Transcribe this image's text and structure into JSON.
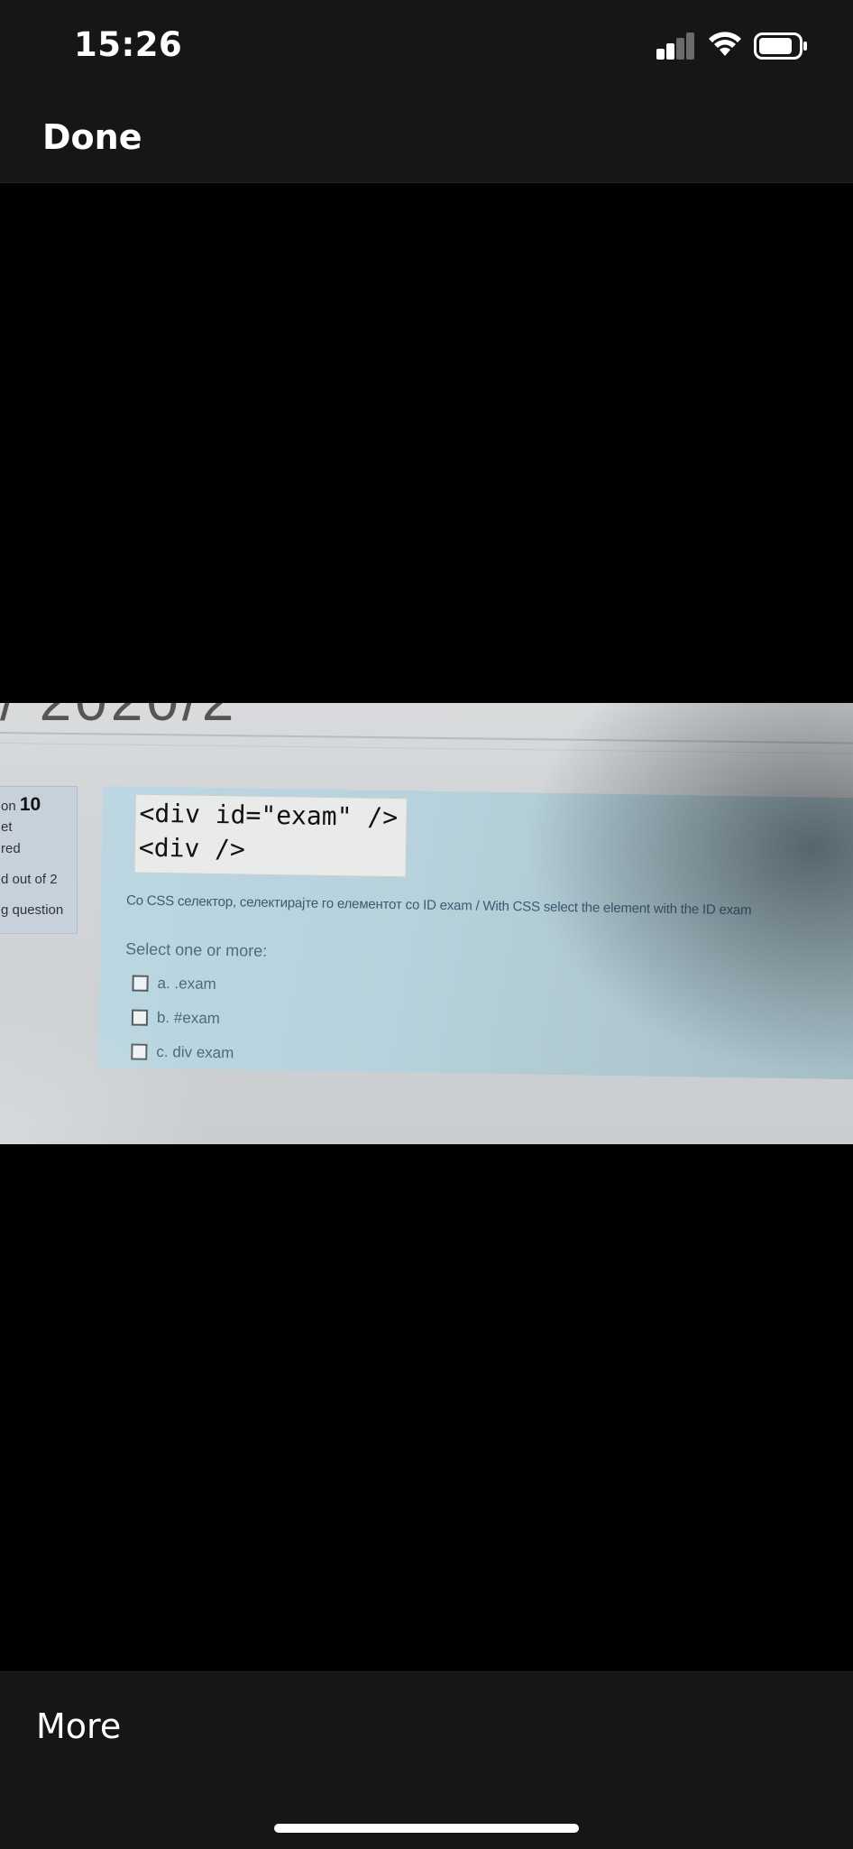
{
  "status_bar": {
    "time": "15:26",
    "signal_bars_active": 2,
    "signal_bars_total": 4
  },
  "nav": {
    "done_label": "Done"
  },
  "photo": {
    "heading_fragment": "/ 2020/2",
    "info_panel": {
      "question_prefix": "on",
      "question_number": "10",
      "line2": "et",
      "line3": "red",
      "line4": "d out of 2",
      "line5": "g question"
    },
    "code_lines": [
      "<div id=\"exam\" />",
      "<div />"
    ],
    "question_text": "Со CSS селектор, селектирајте го елементот со ID exam / With CSS select the element with the ID exam",
    "select_label": "Select one or more:",
    "options": [
      {
        "label": "a. .exam"
      },
      {
        "label": "b. #exam"
      },
      {
        "label": "c. div exam"
      }
    ]
  },
  "bottom": {
    "more_label": "More"
  },
  "colors": {
    "bar_bg": "#161616",
    "photo_question_bg": "#bcd7e2",
    "text_blue": "#4c6a7c"
  }
}
